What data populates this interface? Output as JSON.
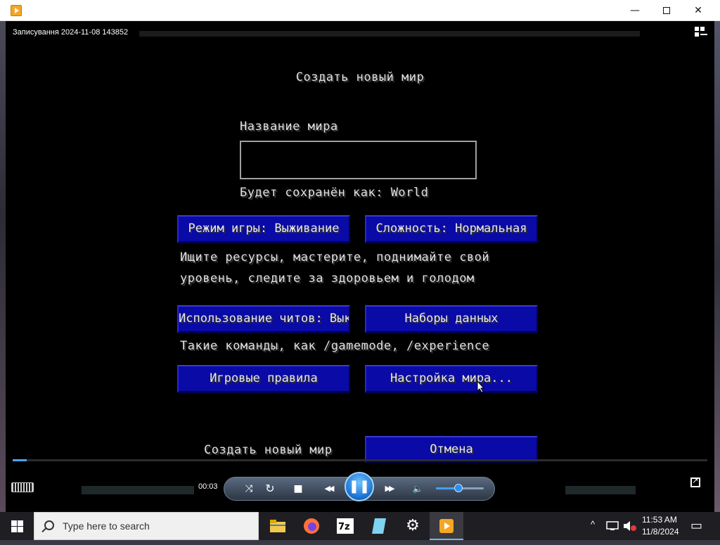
{
  "window": {
    "minimize_glyph": "—",
    "close_glyph": "✕"
  },
  "player": {
    "file_title": "Записування 2024-11-08 143852",
    "elapsed_time": "00:03",
    "progress": 0.02,
    "volume": 0.47
  },
  "minecraft": {
    "screen_title": "Создать новый мир",
    "world_name_label": "Название мира",
    "world_name_value": "",
    "save_as_text": "Будет сохранён как: World",
    "game_mode_button": "Режим игры: Выживание",
    "difficulty_button": "Сложность: Нормальная",
    "game_mode_desc_line1": "Ищите ресурсы, мастерите, поднимайте свой",
    "game_mode_desc_line2": "уровень, следите за здоровьем и голодом",
    "cheats_button": "Использование читов: Выкл",
    "datapacks_button": "Наборы данных",
    "cheats_desc": "Такие команды, как /gamemode, /experience",
    "game_rules_button": "Игровые правила",
    "world_settings_button": "Настройка мира...",
    "create_button": "Создать новый мир",
    "cancel_button": "Отмена"
  },
  "controls": {
    "shuffle_glyph": "⤨",
    "repeat_glyph": "↻",
    "stop_glyph": "■",
    "prev_glyph": "◀◀",
    "pause_glyph": "❚❚",
    "next_glyph": "▶▶",
    "volume_glyph": "🔈"
  },
  "taskbar": {
    "search_placeholder": "Type here to search",
    "time": "11:53 AM",
    "date": "11/8/2024",
    "apps": [
      "file-explorer",
      "firefox",
      "7zip",
      "notes",
      "settings",
      "media-player"
    ],
    "tray_chevron": "^",
    "notification_glyph": "▭"
  },
  "colors": {
    "button_blue": "#0a0aa6",
    "player_accent": "#4aa3ff",
    "taskbar": "#1f1f23"
  }
}
